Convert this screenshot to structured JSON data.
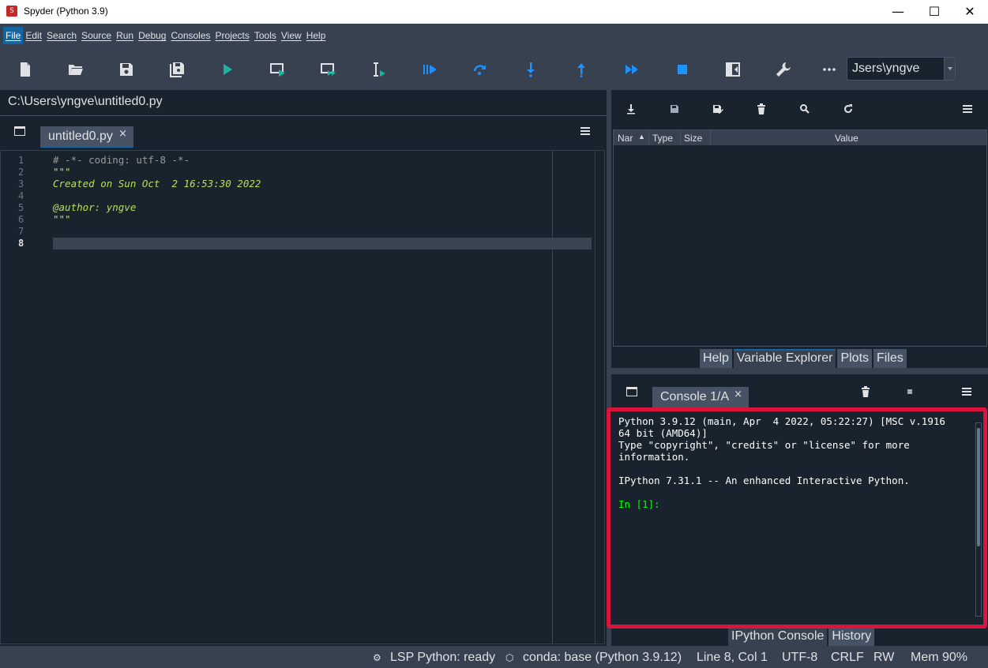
{
  "window": {
    "title": "Spyder (Python 3.9)",
    "app_icon": "spyder-logo",
    "minimize": "—",
    "maximize": "☐",
    "close": "✕"
  },
  "menu": [
    "File",
    "Edit",
    "Search",
    "Source",
    "Run",
    "Debug",
    "Consoles",
    "Projects",
    "Tools",
    "View",
    "Help"
  ],
  "toolbar": {
    "icons": [
      "new-file-icon",
      "open-file-icon",
      "save-icon",
      "save-all-icon",
      "run-icon",
      "run-cell-icon",
      "run-cell-advance-icon",
      "run-selection-icon",
      "debug-icon",
      "step-over-icon",
      "step-into-icon",
      "step-return-icon",
      "continue-icon",
      "stop-icon",
      "maximize-pane-icon",
      "preferences-icon",
      "more-icon"
    ],
    "path_value": "Jsers\\yngve"
  },
  "editor": {
    "file_path": "C:\\Users\\yngve\\untitled0.py",
    "tab_label": "untitled0.py",
    "tab_close": "×",
    "line_numbers": [
      "1",
      "2",
      "3",
      "4",
      "5",
      "6",
      "7",
      "8"
    ],
    "lines": [
      {
        "text": "# -*- coding: utf-8 -*-",
        "style": "comment"
      },
      {
        "text": "\"\"\"",
        "style": "doc"
      },
      {
        "text": "Created on Sun Oct  2 16:53:30 2022",
        "style": "doc"
      },
      {
        "text": "",
        "style": "doc"
      },
      {
        "text": "@author: yngve",
        "style": "doc"
      },
      {
        "text": "\"\"\"",
        "style": "doc"
      },
      {
        "text": "",
        "style": "doc"
      },
      {
        "text": "",
        "style": "doc"
      }
    ],
    "current_line": "8"
  },
  "variable_explorer": {
    "columns": [
      "Nar",
      "Type",
      "Size",
      "Value"
    ],
    "icons": [
      "import-data-icon",
      "save-data-icon",
      "save-data-as-icon",
      "remove-all-icon",
      "search-icon",
      "refresh-icon"
    ]
  },
  "top_right_tabs": [
    "Help",
    "Variable Explorer",
    "Plots",
    "Files"
  ],
  "console": {
    "tab_label": "Console 1/A",
    "tab_close": "×",
    "output": [
      "Python 3.9.12 (main, Apr  4 2022, 05:22:27) [MSC v.1916",
      "64 bit (AMD64)]",
      "Type \"copyright\", \"credits\" or \"license\" for more",
      "information.",
      "",
      "IPython 7.31.1 -- An enhanced Interactive Python.",
      "",
      "In [1]:"
    ]
  },
  "bottom_right_tabs": [
    "IPython Console",
    "History"
  ],
  "status": {
    "lsp": "LSP Python: ready",
    "conda": "conda: base (Python 3.9.12)",
    "position": "Line 8, Col 1",
    "encoding": "UTF-8",
    "eol": "CRLF",
    "permissions": "RW",
    "memory": "Mem 90%"
  },
  "colors": {
    "accent": "#1464a0",
    "highlight_border": "#dc143c",
    "background": "#19232d",
    "toolbar": "#37414f",
    "run_icon": "#19b5a0",
    "debug_icon": "#1e90ff"
  }
}
